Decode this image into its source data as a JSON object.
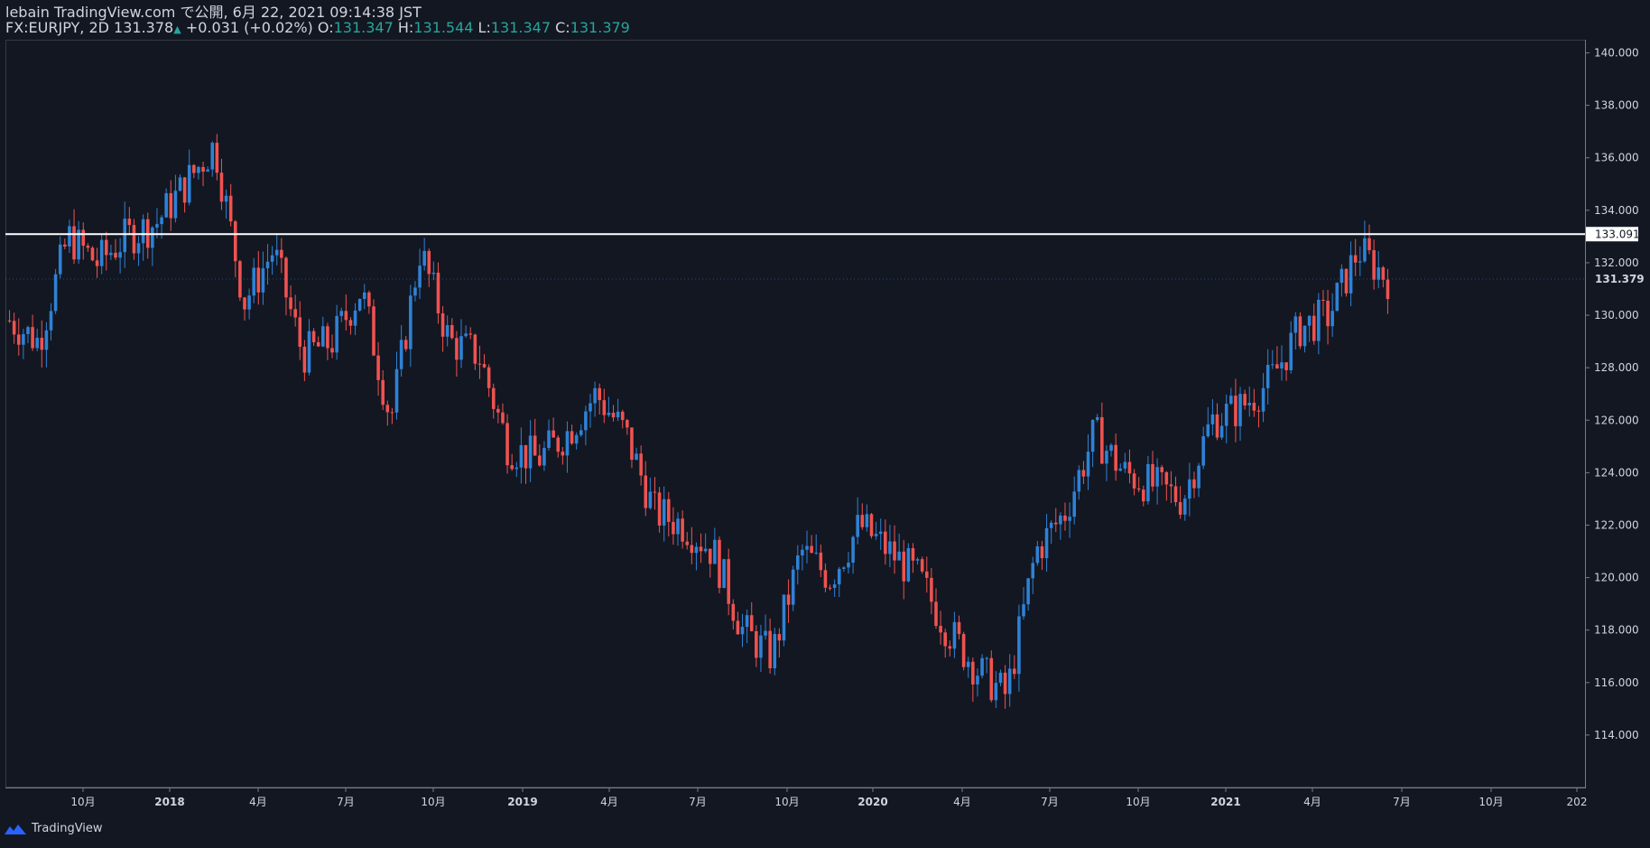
{
  "header": {
    "line1": "lebain TradingView.com で公開, 6月 22, 2021 09:14:38 JST",
    "symbol": "FX:EURJPY, 2D",
    "last": "131.378",
    "arrow": "▲",
    "change": "+0.031 (+0.02%)",
    "o_label": "O:",
    "o_value": "131.347",
    "h_label": "H:",
    "h_value": "131.544",
    "l_label": "L:",
    "l_value": "131.347",
    "c_label": "C:",
    "c_value": "131.379"
  },
  "footer": {
    "brand": "TradingView"
  },
  "colors": {
    "up": "#2e82d6",
    "down": "#ef5350",
    "bg": "#131722",
    "text": "#d1d4dc",
    "ohlc": "#26a69a",
    "hline": "#ffffff"
  },
  "chart_data": {
    "type": "candlestick",
    "ylim": [
      112,
      140.5
    ],
    "y_ticks": [
      "114.000",
      "116.000",
      "118.000",
      "120.000",
      "122.000",
      "124.000",
      "126.000",
      "128.000",
      "130.000",
      "132.000",
      "134.000",
      "136.000",
      "138.000",
      "140.000"
    ],
    "x_ticks": [
      "10月",
      "2018",
      "4月",
      "7月",
      "10月",
      "2019",
      "4月",
      "7月",
      "10月",
      "2020",
      "4月",
      "7月",
      "10月",
      "2021",
      "4月",
      "7月",
      "10月",
      "202"
    ],
    "horizontal_line": {
      "value": 133.091,
      "label": "133.091"
    },
    "last_price": {
      "value": 131.379,
      "label": "131.379"
    },
    "series": [
      {
        "x": "2017-07",
        "y": 129.8
      },
      {
        "x": "2017-08",
        "y": 129.0
      },
      {
        "x": "2017-09",
        "y": 133.0
      },
      {
        "x": "2017-10",
        "y": 132.0
      },
      {
        "x": "2017-11",
        "y": 133.0
      },
      {
        "x": "2017-12",
        "y": 133.5
      },
      {
        "x": "2018-01",
        "y": 135.0
      },
      {
        "x": "2018-02",
        "y": 136.5
      },
      {
        "x": "2018-03",
        "y": 130.5
      },
      {
        "x": "2018-04",
        "y": 132.5
      },
      {
        "x": "2018-05",
        "y": 128.5
      },
      {
        "x": "2018-06",
        "y": 129.0
      },
      {
        "x": "2018-07",
        "y": 131.0
      },
      {
        "x": "2018-08",
        "y": 126.0
      },
      {
        "x": "2018-09",
        "y": 132.5
      },
      {
        "x": "2018-10",
        "y": 129.0
      },
      {
        "x": "2018-11",
        "y": 128.5
      },
      {
        "x": "2018-12",
        "y": 125.0
      },
      {
        "x": "2019-01",
        "y": 124.5
      },
      {
        "x": "2019-02",
        "y": 125.5
      },
      {
        "x": "2019-03",
        "y": 127.0
      },
      {
        "x": "2019-04",
        "y": 125.5
      },
      {
        "x": "2019-05",
        "y": 122.5
      },
      {
        "x": "2019-06",
        "y": 122.0
      },
      {
        "x": "2019-07",
        "y": 121.0
      },
      {
        "x": "2019-08",
        "y": 118.0
      },
      {
        "x": "2019-09",
        "y": 117.0
      },
      {
        "x": "2019-10",
        "y": 121.0
      },
      {
        "x": "2019-11",
        "y": 120.0
      },
      {
        "x": "2019-12",
        "y": 122.0
      },
      {
        "x": "2020-01",
        "y": 121.0
      },
      {
        "x": "2020-02",
        "y": 120.0
      },
      {
        "x": "2020-03",
        "y": 118.0
      },
      {
        "x": "2020-04",
        "y": 116.5
      },
      {
        "x": "2020-05",
        "y": 115.5
      },
      {
        "x": "2020-06",
        "y": 121.0
      },
      {
        "x": "2020-07",
        "y": 122.5
      },
      {
        "x": "2020-08",
        "y": 125.5
      },
      {
        "x": "2020-09",
        "y": 124.0
      },
      {
        "x": "2020-10",
        "y": 123.5
      },
      {
        "x": "2020-11",
        "y": 123.0
      },
      {
        "x": "2020-12",
        "y": 126.0
      },
      {
        "x": "2021-01",
        "y": 126.5
      },
      {
        "x": "2021-02",
        "y": 127.5
      },
      {
        "x": "2021-03",
        "y": 129.5
      },
      {
        "x": "2021-04",
        "y": 130.0
      },
      {
        "x": "2021-05",
        "y": 132.5
      },
      {
        "x": "2021-06",
        "y": 131.4
      }
    ]
  }
}
